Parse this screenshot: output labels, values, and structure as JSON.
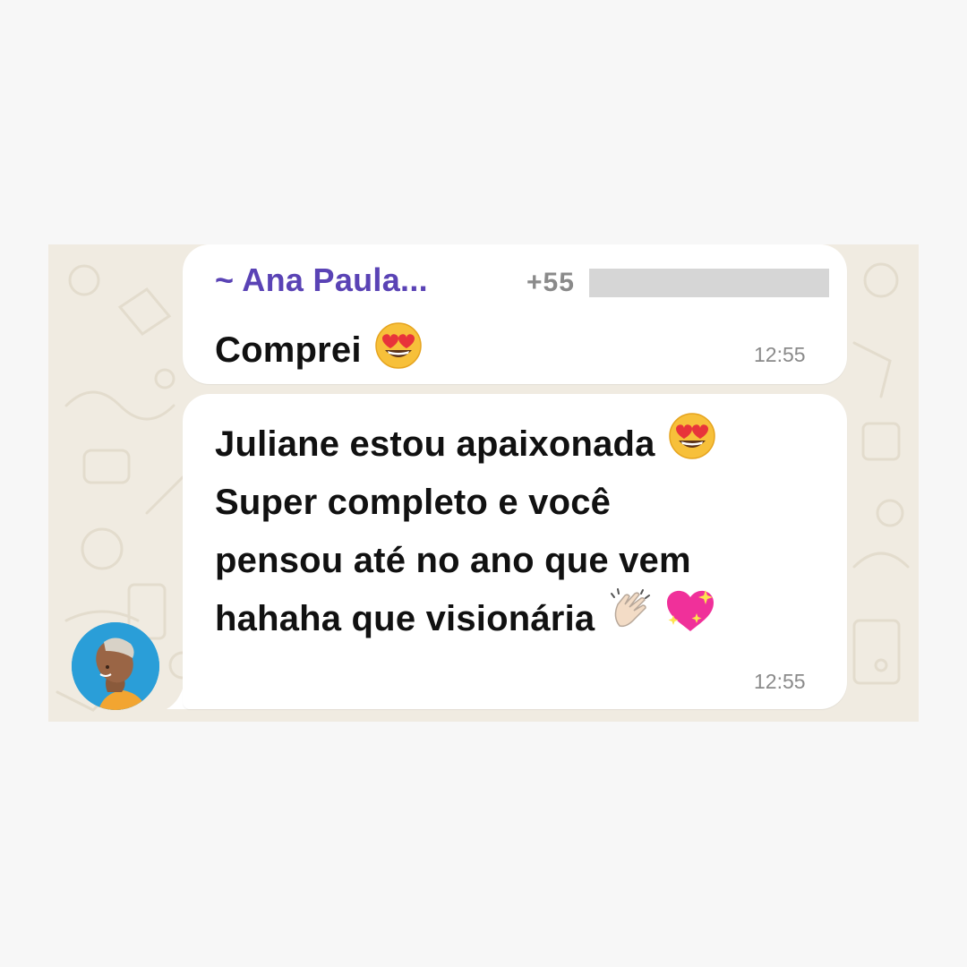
{
  "messages": [
    {
      "sender_name": "~ Ana Paula...",
      "sender_phone": "+55",
      "text": "Comprei",
      "emoji": "heart-eyes-emoji",
      "time": "12:55"
    },
    {
      "lines": [
        "Juliane estou apaixonada",
        "Super completo e você",
        "pensou até no ano que vem",
        "hahaha que visionária"
      ],
      "emojis": [
        "heart-eyes-emoji",
        "clapping-hands-emoji",
        "sparkling-heart-emoji"
      ],
      "time": "12:55"
    }
  ],
  "colors": {
    "chat_background": "#f0ebe1",
    "bubble": "#ffffff",
    "sender_name": "#5a43b5",
    "timestamp": "#8a8a8a",
    "avatar_background": "#2a9ed8"
  }
}
